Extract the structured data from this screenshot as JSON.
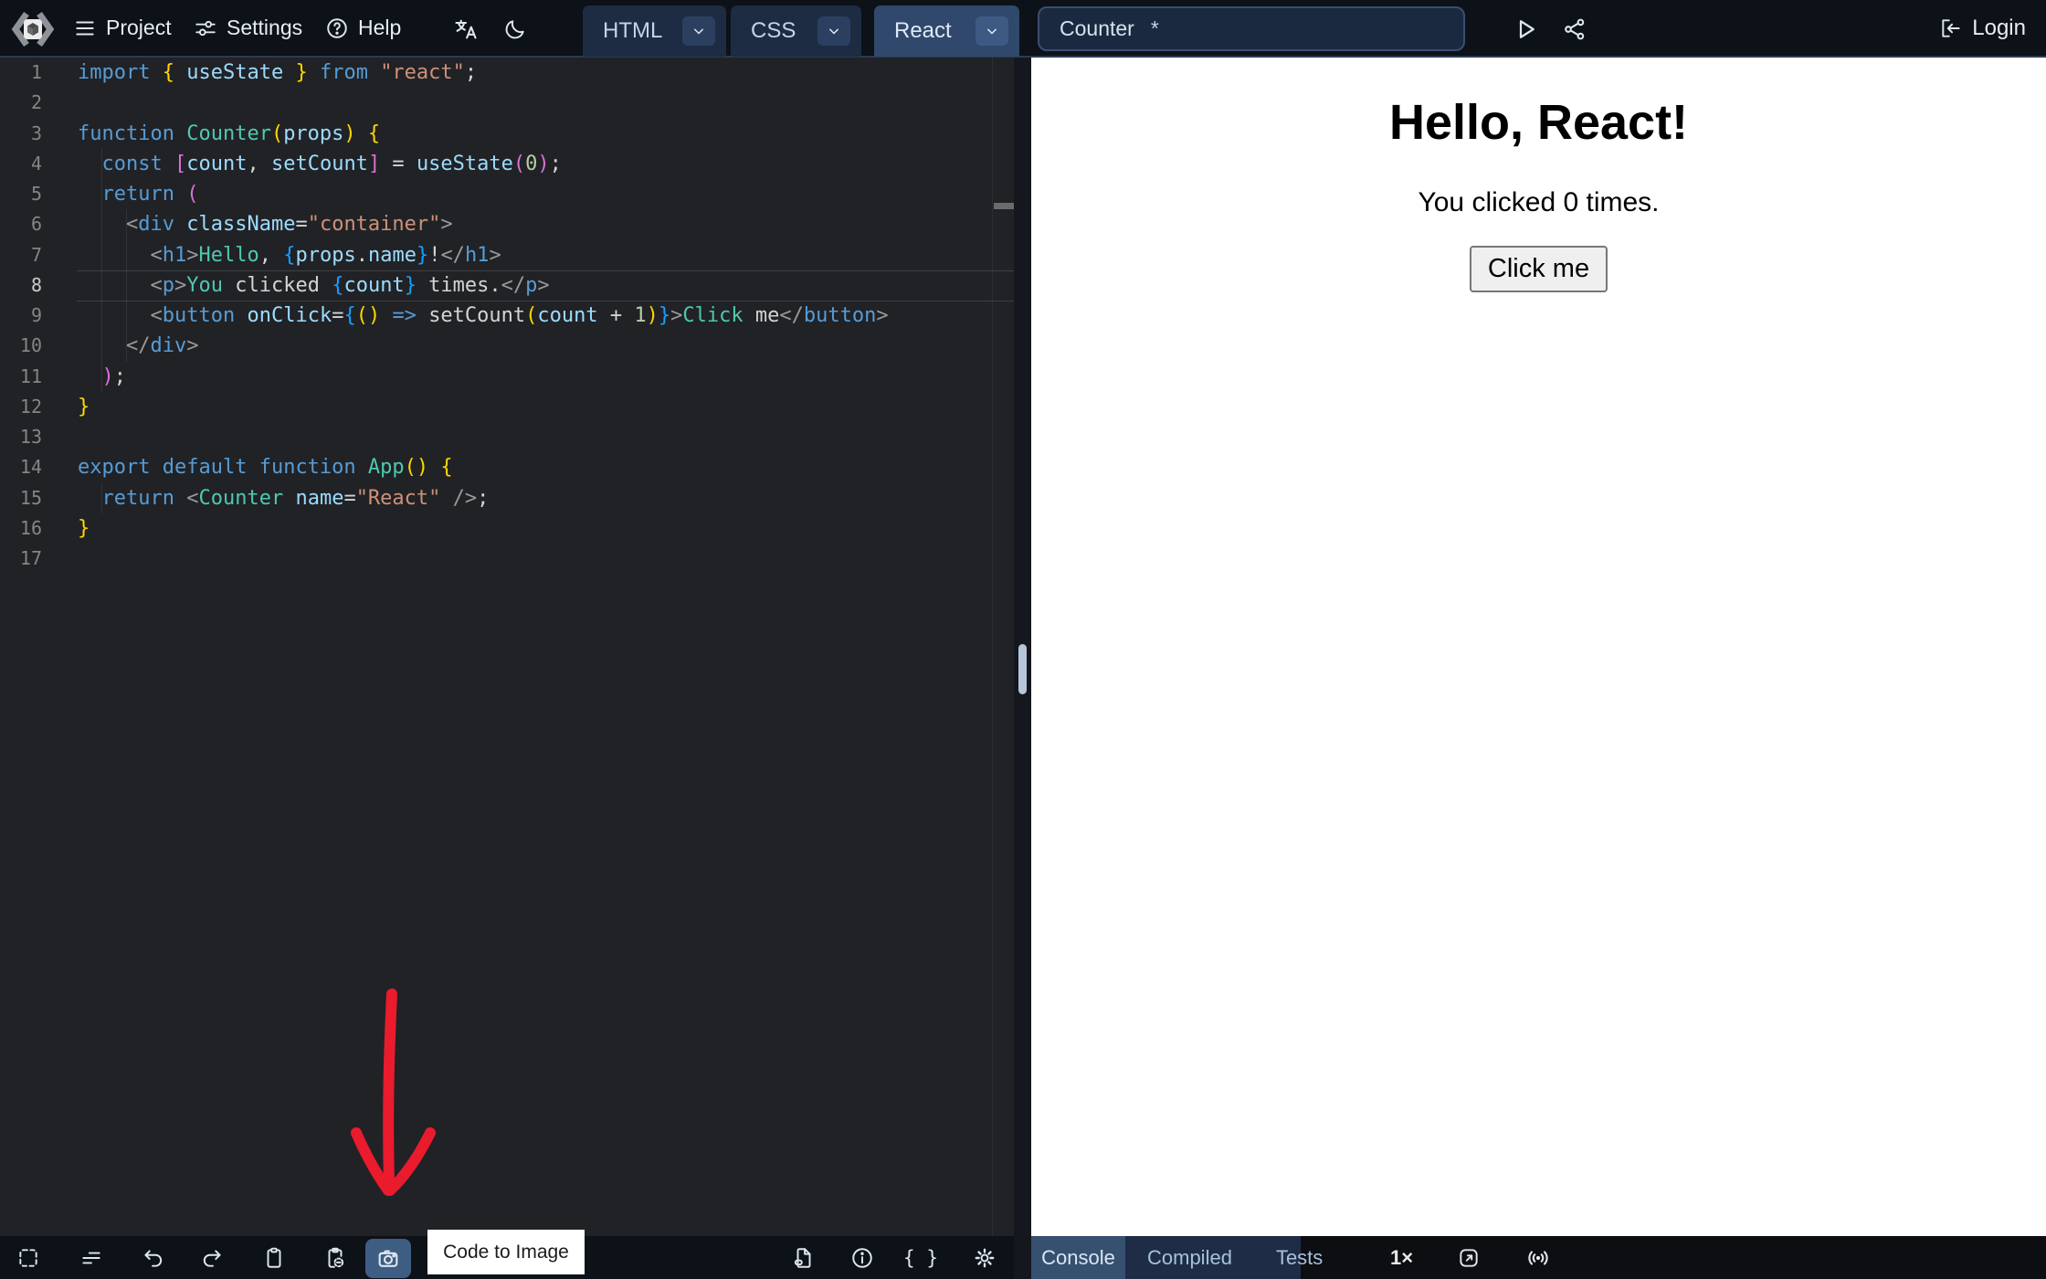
{
  "nav": {
    "menus": [
      {
        "label": "Project",
        "icon": "hamburger-icon"
      },
      {
        "label": "Settings",
        "icon": "sliders-icon"
      },
      {
        "label": "Help",
        "icon": "help-circle-icon"
      }
    ],
    "tabs": [
      {
        "label": "HTML",
        "active": false
      },
      {
        "label": "CSS",
        "active": false
      },
      {
        "label": "React",
        "active": true
      }
    ],
    "project_title": "Counter",
    "dirty_marker": "*",
    "login_label": "Login"
  },
  "editor": {
    "lines": [
      {
        "num": 1,
        "segs": [
          [
            "import",
            "kw"
          ],
          [
            " ",
            "pun"
          ],
          [
            "{",
            "br1"
          ],
          [
            " ",
            "pun"
          ],
          [
            "useState",
            "var"
          ],
          [
            " ",
            "pun"
          ],
          [
            "}",
            "br1"
          ],
          [
            " ",
            "pun"
          ],
          [
            "from",
            "kw"
          ],
          [
            " ",
            "pun"
          ],
          [
            "\"react\"",
            "str"
          ],
          [
            ";",
            "pun"
          ]
        ]
      },
      {
        "num": 2,
        "segs": []
      },
      {
        "num": 3,
        "segs": [
          [
            "function",
            "kw"
          ],
          [
            " ",
            "pun"
          ],
          [
            "Counter",
            "type"
          ],
          [
            "(",
            "br1"
          ],
          [
            "props",
            "var"
          ],
          [
            ")",
            "br1"
          ],
          [
            " ",
            "pun"
          ],
          [
            "{",
            "br1"
          ]
        ]
      },
      {
        "num": 4,
        "segs": [
          [
            "  ",
            "pun"
          ],
          [
            "const",
            "kw"
          ],
          [
            " ",
            "pun"
          ],
          [
            "[",
            "br2"
          ],
          [
            "count",
            "var"
          ],
          [
            ", ",
            "pun"
          ],
          [
            "setCount",
            "var"
          ],
          [
            "]",
            "br2"
          ],
          [
            " = ",
            "pun"
          ],
          [
            "useState",
            "var"
          ],
          [
            "(",
            "br2"
          ],
          [
            "0",
            "num"
          ],
          [
            ")",
            "br2"
          ],
          [
            ";",
            "pun"
          ]
        ]
      },
      {
        "num": 5,
        "segs": [
          [
            "  ",
            "pun"
          ],
          [
            "return",
            "kw"
          ],
          [
            " ",
            "pun"
          ],
          [
            "(",
            "br2"
          ]
        ]
      },
      {
        "num": 6,
        "segs": [
          [
            "    ",
            "pun"
          ],
          [
            "<",
            "angle"
          ],
          [
            "div",
            "tag"
          ],
          [
            " ",
            "pun"
          ],
          [
            "className",
            "var"
          ],
          [
            "=",
            "pun"
          ],
          [
            "\"container\"",
            "str"
          ],
          [
            ">",
            "angle"
          ]
        ]
      },
      {
        "num": 7,
        "segs": [
          [
            "      ",
            "pun"
          ],
          [
            "<",
            "angle"
          ],
          [
            "h1",
            "tag"
          ],
          [
            ">",
            "angle"
          ],
          [
            "Hello",
            "type"
          ],
          [
            ", ",
            "pun"
          ],
          [
            "{",
            "br3"
          ],
          [
            "props",
            "var"
          ],
          [
            ".",
            "pun"
          ],
          [
            "name",
            "var"
          ],
          [
            "}",
            "br3"
          ],
          [
            "!",
            "pun"
          ],
          [
            "</",
            "angle"
          ],
          [
            "h1",
            "tag"
          ],
          [
            ">",
            "angle"
          ]
        ]
      },
      {
        "num": 8,
        "current": true,
        "segs": [
          [
            "      ",
            "pun"
          ],
          [
            "<",
            "angle"
          ],
          [
            "p",
            "tag"
          ],
          [
            ">",
            "angle"
          ],
          [
            "You",
            "type"
          ],
          [
            " clicked ",
            "pun"
          ],
          [
            "{",
            "br3"
          ],
          [
            "count",
            "var"
          ],
          [
            "}",
            "br3"
          ],
          [
            " times.",
            "pun"
          ],
          [
            "</",
            "angle"
          ],
          [
            "p",
            "tag"
          ],
          [
            ">",
            "angle"
          ]
        ]
      },
      {
        "num": 9,
        "segs": [
          [
            "      ",
            "pun"
          ],
          [
            "<",
            "angle"
          ],
          [
            "button",
            "tag"
          ],
          [
            " ",
            "pun"
          ],
          [
            "onClick",
            "var"
          ],
          [
            "=",
            "pun"
          ],
          [
            "{",
            "br3"
          ],
          [
            "(",
            "br1"
          ],
          [
            ")",
            "br1"
          ],
          [
            " ",
            "pun"
          ],
          [
            "=>",
            "kw"
          ],
          [
            " ",
            "pun"
          ],
          [
            "setCount",
            "pun"
          ],
          [
            "(",
            "br1"
          ],
          [
            "count",
            "var"
          ],
          [
            " + ",
            "pun"
          ],
          [
            "1",
            "num"
          ],
          [
            ")",
            "br1"
          ],
          [
            "}",
            "br3"
          ],
          [
            ">",
            "angle"
          ],
          [
            "Click",
            "type"
          ],
          [
            " me",
            "pun"
          ],
          [
            "</",
            "angle"
          ],
          [
            "button",
            "tag"
          ],
          [
            ">",
            "angle"
          ]
        ]
      },
      {
        "num": 10,
        "segs": [
          [
            "    ",
            "pun"
          ],
          [
            "</",
            "angle"
          ],
          [
            "div",
            "tag"
          ],
          [
            ">",
            "angle"
          ]
        ]
      },
      {
        "num": 11,
        "segs": [
          [
            "  ",
            "pun"
          ],
          [
            ")",
            "br2"
          ],
          [
            ";",
            "pun"
          ]
        ]
      },
      {
        "num": 12,
        "segs": [
          [
            "}",
            "br1"
          ]
        ]
      },
      {
        "num": 13,
        "segs": []
      },
      {
        "num": 14,
        "segs": [
          [
            "export",
            "kw"
          ],
          [
            " ",
            "pun"
          ],
          [
            "default",
            "kw"
          ],
          [
            " ",
            "pun"
          ],
          [
            "function",
            "kw"
          ],
          [
            " ",
            "pun"
          ],
          [
            "App",
            "type"
          ],
          [
            "(",
            "br1"
          ],
          [
            ")",
            "br1"
          ],
          [
            " ",
            "pun"
          ],
          [
            "{",
            "br1"
          ]
        ]
      },
      {
        "num": 15,
        "segs": [
          [
            "  ",
            "pun"
          ],
          [
            "return",
            "kw"
          ],
          [
            " ",
            "pun"
          ],
          [
            "<",
            "angle"
          ],
          [
            "Counter",
            "type"
          ],
          [
            " ",
            "pun"
          ],
          [
            "name",
            "var"
          ],
          [
            "=",
            "pun"
          ],
          [
            "\"React\"",
            "str"
          ],
          [
            " ",
            "pun"
          ],
          [
            "/>",
            "angle"
          ],
          [
            ";",
            "pun"
          ]
        ]
      },
      {
        "num": 16,
        "segs": [
          [
            "}",
            "br1"
          ]
        ]
      },
      {
        "num": 17,
        "segs": []
      }
    ]
  },
  "preview": {
    "heading": "Hello, React!",
    "message": "You clicked 0 times.",
    "button_label": "Click me"
  },
  "editor_footer": {
    "tooltip": "Code to Image"
  },
  "preview_footer": {
    "tabs": [
      {
        "label": "Console",
        "active": true
      },
      {
        "label": "Compiled",
        "active": false
      },
      {
        "label": "Tests",
        "active": false
      }
    ],
    "zoom_label": "1×"
  },
  "icons": [
    "playcode-logo",
    "hamburger-icon",
    "sliders-icon",
    "help-circle-icon",
    "translate-icon",
    "moon-icon",
    "chevron-down-icon",
    "play-icon",
    "share-icon",
    "login-icon",
    "selection-icon",
    "format-icon",
    "undo-icon",
    "redo-icon",
    "clipboard-icon",
    "clipboard-minus-icon",
    "camera-icon",
    "file-link-icon",
    "info-icon",
    "braces-icon",
    "gear-icon",
    "open-external-icon",
    "broadcast-icon",
    "red-arrow-annotation"
  ],
  "colors": {
    "nav_bg": "#0d1118",
    "editor_bg": "#212226",
    "active_tab": "#30486b",
    "inactive_tab": "#1d2c43",
    "camera_button": "#3e5d82",
    "console_tab": "#36506f",
    "arrow_red": "#ea1b2d",
    "tooltip_bg": "#ffffff"
  }
}
